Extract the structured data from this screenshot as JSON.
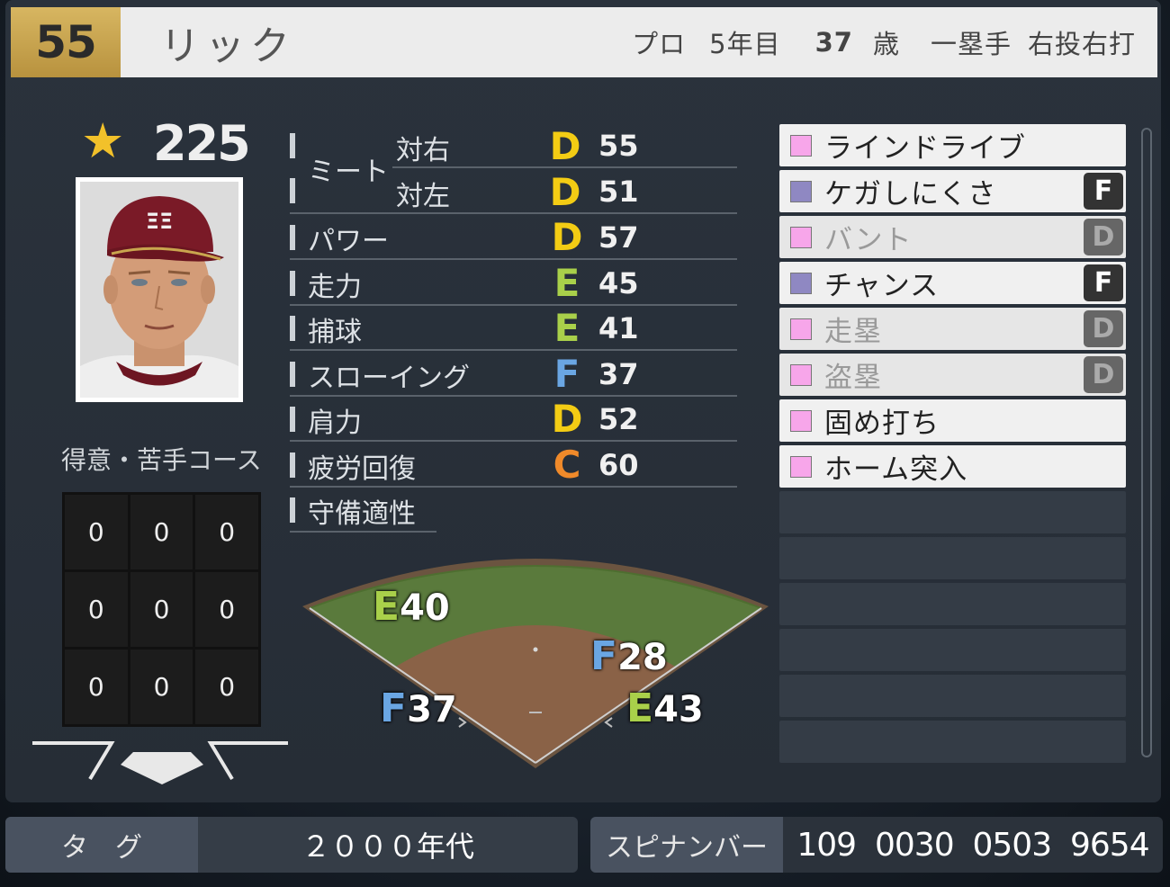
{
  "header": {
    "uniform_number": "55",
    "player_name": "リック",
    "status": "プロ",
    "years": "5年目",
    "age": "37",
    "age_unit": "歳",
    "position": "一塁手",
    "throw_bat": "右投右打"
  },
  "overall": {
    "icon": "star-icon",
    "value": "225"
  },
  "zone": {
    "title": "得意・苦手コース",
    "cells": [
      "0",
      "0",
      "0",
      "0",
      "0",
      "0",
      "0",
      "0",
      "0"
    ]
  },
  "stats": {
    "meet_label": "ミート",
    "meet_right_label": "対右",
    "meet_right_grade": "D",
    "meet_right_value": "55",
    "meet_left_label": "対左",
    "meet_left_grade": "D",
    "meet_left_value": "51",
    "power_label": "パワー",
    "power_grade": "D",
    "power_value": "57",
    "speed_label": "走力",
    "speed_grade": "E",
    "speed_value": "45",
    "catch_label": "捕球",
    "catch_grade": "E",
    "catch_value": "41",
    "throw_label": "スローイング",
    "throw_grade": "F",
    "throw_value": "37",
    "arm_label": "肩力",
    "arm_grade": "D",
    "arm_value": "52",
    "recovery_label": "疲労回復",
    "recovery_grade": "C",
    "recovery_value": "60",
    "defense_label": "守備適性"
  },
  "field": {
    "first_grade": "E",
    "first_value": "43",
    "third_grade": "F",
    "third_value": "37",
    "left_grade": "E",
    "left_value": "40",
    "right_grade": "F",
    "right_value": "28"
  },
  "abilities": [
    {
      "label": "ラインドライブ",
      "badge": ""
    },
    {
      "label": "ケガしにくさ",
      "badge": "F"
    },
    {
      "label": "バント",
      "badge": "D"
    },
    {
      "label": "チャンス",
      "badge": "F"
    },
    {
      "label": "走塁",
      "badge": "D"
    },
    {
      "label": "盗塁",
      "badge": "D"
    },
    {
      "label": "固め打ち",
      "badge": ""
    },
    {
      "label": "ホーム突入",
      "badge": ""
    }
  ],
  "colors": {
    "pink": "#f7a6ea",
    "purple": "#8f88c2",
    "gold": "#c9a54e"
  },
  "footer": {
    "tag_label": "タ　グ",
    "tag_value": "２０００年代",
    "spin_label": "スピナンバー",
    "spin_value": "109  0030  0503  9654"
  }
}
